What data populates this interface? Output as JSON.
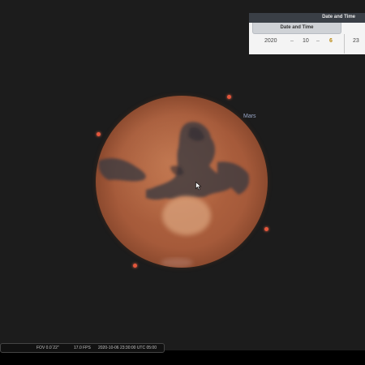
{
  "object": {
    "name": "Mars"
  },
  "date_panel": {
    "tab_title": "Date and Time",
    "header": "Date and Time",
    "year": "2020",
    "month": "10",
    "day": "6",
    "hour": "23",
    "separator": "–"
  },
  "status_bar": {
    "fov": "FOV 0.0´22\"",
    "fps": "17.0 FPS",
    "datetime": "2020-10-06 23:30:00 UTC 05:00"
  },
  "colors": {
    "sky": "#1c1c1c",
    "planet": "#a55a3a",
    "moon": "#e4563c",
    "label": "#9aa7c7",
    "day_highlight": "#b8860b"
  },
  "icons": {
    "cursor": "mouse-pointer-icon"
  }
}
